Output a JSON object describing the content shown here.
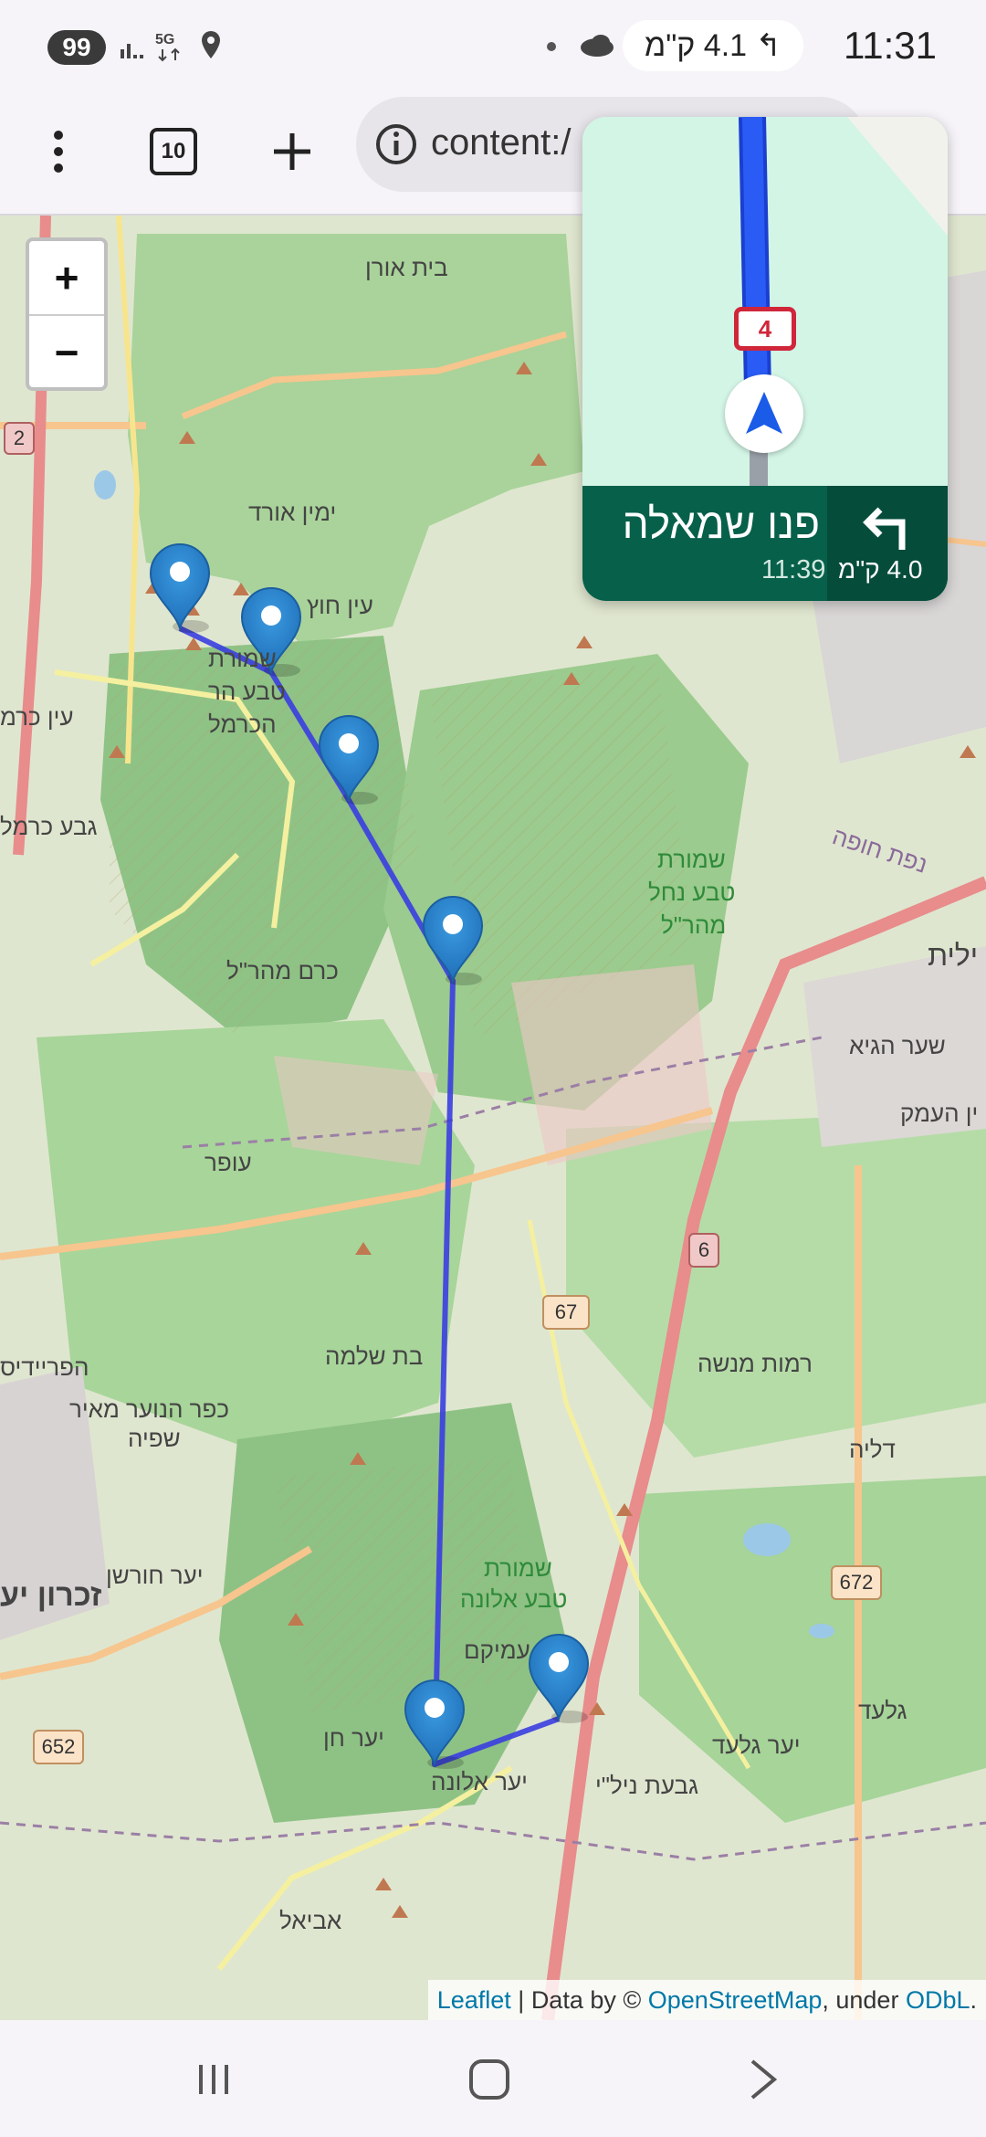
{
  "status_bar": {
    "notification_count": "99",
    "time": "11:31",
    "nav_chip": "4.1 ק\"מ",
    "icons": [
      "signal-icon",
      "5g-data-icon",
      "location-icon",
      "dot-icon",
      "cloud-icon",
      "voicemail-icon",
      "turn-left-icon"
    ]
  },
  "toolbar": {
    "tab_count": "10",
    "url_text": "content:/"
  },
  "map": {
    "zoom_in": "+",
    "zoom_out": "−",
    "labels": [
      {
        "name": "bet-oren",
        "text": "בית אורן"
      },
      {
        "name": "yemin-orde",
        "text": "ימין אורד"
      },
      {
        "name": "ein-hod",
        "text": "עין חוץ"
      },
      {
        "name": "reserve-carmel-1",
        "text": "שמורת"
      },
      {
        "name": "reserve-carmel-2",
        "text": "טבע הר"
      },
      {
        "name": "reserve-carmel-3",
        "text": "הכרמל"
      },
      {
        "name": "ein-carmel",
        "text": "עין כרמ"
      },
      {
        "name": "geva-carmel",
        "text": "גבע כרמל"
      },
      {
        "name": "kerem-maharal",
        "text": "כרם מהר\"ל"
      },
      {
        "name": "ofer",
        "text": "עופר"
      },
      {
        "name": "reserve-maharal-1",
        "text": "שמורת"
      },
      {
        "name": "reserve-maharal-2",
        "text": "טבע נחל"
      },
      {
        "name": "reserve-maharal-3",
        "text": "מהר\"ל"
      },
      {
        "name": "nefet-hofa",
        "text": "נפת חופה"
      },
      {
        "name": "yilit",
        "text": "ילית"
      },
      {
        "name": "shaar-hagai",
        "text": "שער הגיא"
      },
      {
        "name": "yin-haemek",
        "text": "ין העמק"
      },
      {
        "name": "bat-shlomo",
        "text": "בת שלמה"
      },
      {
        "name": "fureidis",
        "text": "הפריידיס"
      },
      {
        "name": "kfar-hanoar-1",
        "text": "כפר הנוער מאיר"
      },
      {
        "name": "kfar-hanoar-2",
        "text": "שפיה"
      },
      {
        "name": "ramot-menashe",
        "text": "רמות מנשה"
      },
      {
        "name": "dalia",
        "text": "דליה"
      },
      {
        "name": "yaar-horshan",
        "text": "יער חורשן"
      },
      {
        "name": "zichron",
        "text": "זכרון יע"
      },
      {
        "name": "reserve-alona-1",
        "text": "שמורת"
      },
      {
        "name": "reserve-alona-2",
        "text": "טבע אלונה"
      },
      {
        "name": "amikam",
        "text": "עמיקם"
      },
      {
        "name": "yaar-hen",
        "text": "יער חן"
      },
      {
        "name": "yaar-alona",
        "text": "יער אלונה"
      },
      {
        "name": "galed",
        "text": "גלעד"
      },
      {
        "name": "yaar-galed",
        "text": "יער גלעד"
      },
      {
        "name": "givat-nili",
        "text": "גבעת ניל\"י"
      },
      {
        "name": "aviel",
        "text": "אביאל"
      },
      {
        "name": "road-2",
        "text": "2"
      },
      {
        "name": "road-4",
        "text": "4"
      },
      {
        "name": "road-6",
        "text": "6"
      },
      {
        "name": "road-67",
        "text": "67"
      },
      {
        "name": "road-652",
        "text": "652"
      },
      {
        "name": "road-672",
        "text": "672"
      }
    ],
    "attribution": {
      "leaflet": "Leaflet",
      "sep1": " | Data by © ",
      "osm": "OpenStreetMap",
      "sep2": ", under ",
      "odbl": "ODbL",
      "end": "."
    }
  },
  "nav_card": {
    "shield": "4",
    "street": "פנו שמאלה",
    "eta": "11:39",
    "distance": "4.0 ק\"מ"
  },
  "nav_bar": {
    "icons": [
      "recent-apps-icon",
      "home-icon",
      "back-icon"
    ]
  }
}
